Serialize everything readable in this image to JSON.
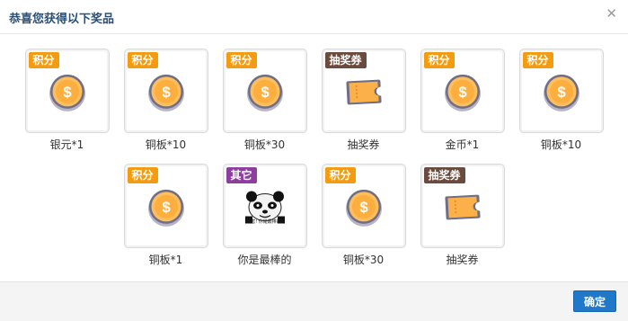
{
  "dialog": {
    "title": "恭喜您获得以下奖品",
    "confirm_label": "确定"
  },
  "colors": {
    "badge_points": "#f39c12",
    "badge_ticket": "#6b4b3e",
    "badge_other": "#8e3e9f",
    "primary_button": "#1f78c9"
  },
  "rows": [
    [
      {
        "badge": "积分",
        "badge_type": "points",
        "icon": "coin-icon",
        "name": "银元*1"
      },
      {
        "badge": "积分",
        "badge_type": "points",
        "icon": "coin-icon",
        "name": "铜板*10"
      },
      {
        "badge": "积分",
        "badge_type": "points",
        "icon": "coin-icon",
        "name": "铜板*30"
      },
      {
        "badge": "抽奖券",
        "badge_type": "ticket",
        "icon": "ticket-icon",
        "name": "抽奖券"
      },
      {
        "badge": "积分",
        "badge_type": "points",
        "icon": "coin-icon",
        "name": "金币*1"
      },
      {
        "badge": "积分",
        "badge_type": "points",
        "icon": "coin-icon",
        "name": "铜板*10"
      }
    ],
    [
      {
        "badge": "积分",
        "badge_type": "points",
        "icon": "coin-icon",
        "name": "铜板*1"
      },
      {
        "badge": "其它",
        "badge_type": "other",
        "icon": "meme-icon",
        "name": "你是最棒的",
        "image_caption": "厉害! 你是最棒的!"
      },
      {
        "badge": "积分",
        "badge_type": "points",
        "icon": "coin-icon",
        "name": "铜板*30"
      },
      {
        "badge": "抽奖券",
        "badge_type": "ticket",
        "icon": "ticket-icon",
        "name": "抽奖券"
      }
    ]
  ]
}
